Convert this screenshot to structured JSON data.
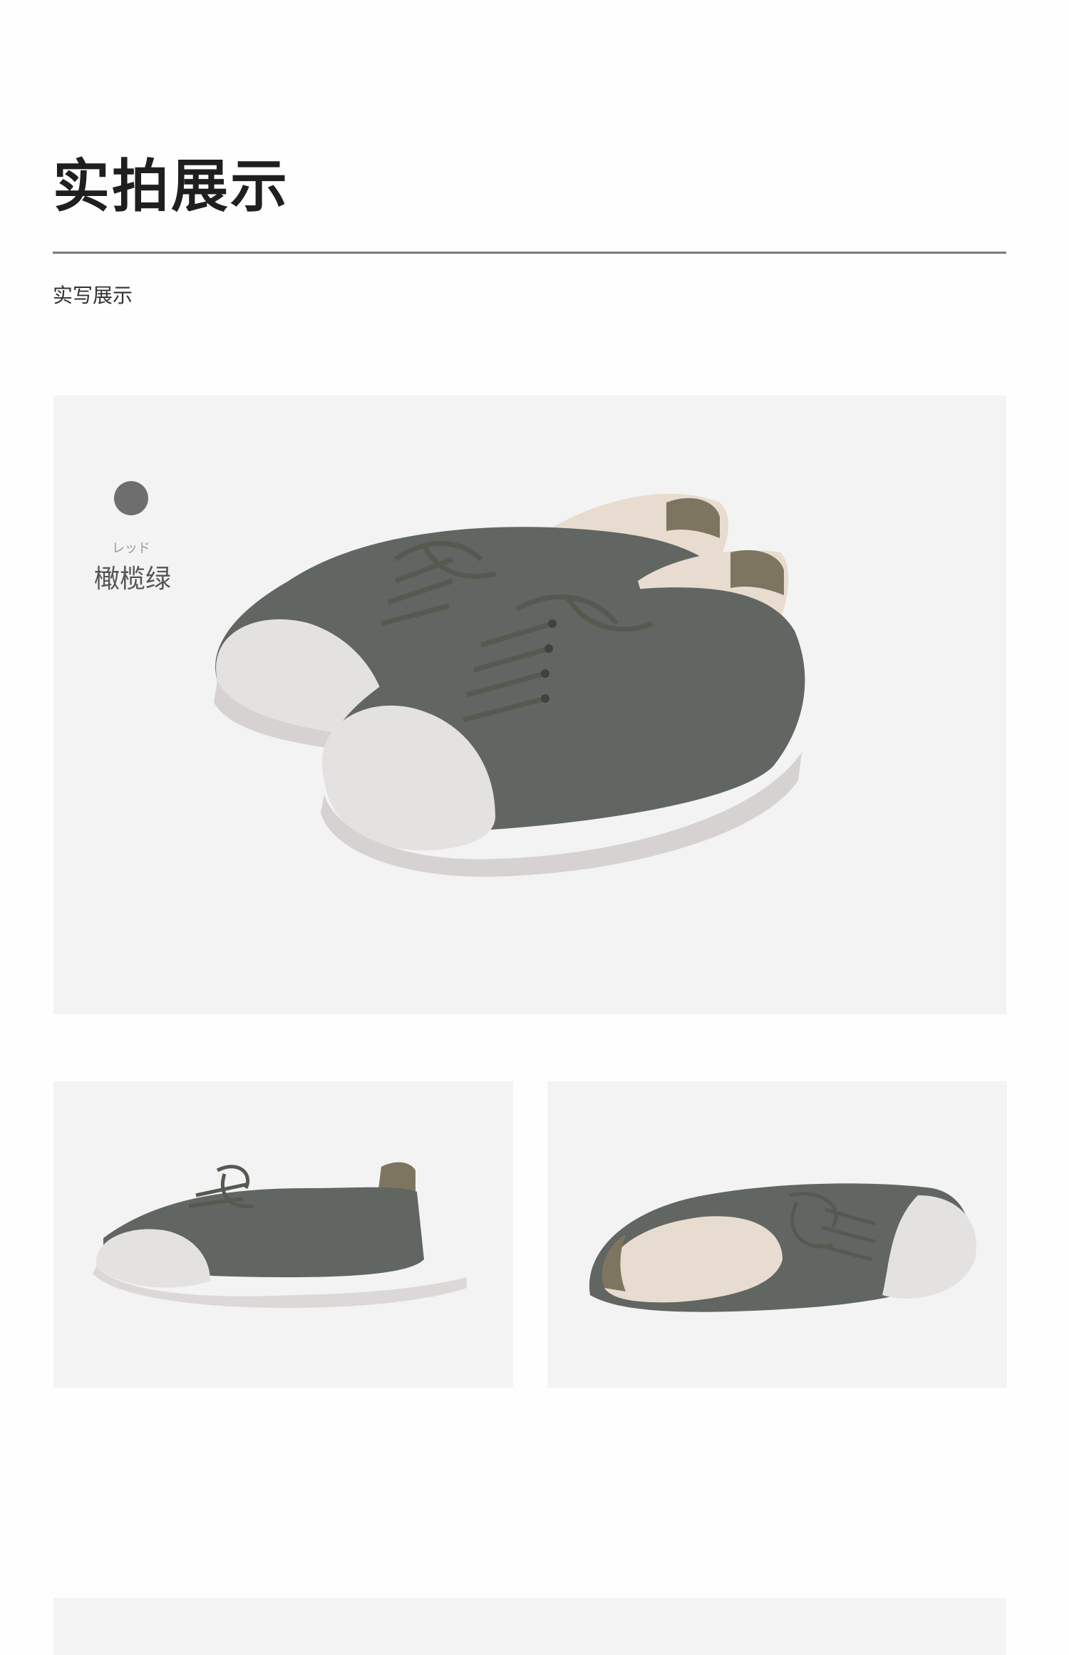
{
  "header": {
    "title": "实拍展示",
    "subtitle": "实写展示"
  },
  "hero": {
    "swatch_color": "#6e6e6e",
    "swatch_label_jp": "レッド",
    "swatch_label_cn": "橄榄绿"
  },
  "colors": {
    "upper": "#626662",
    "lace": "#55594f",
    "sole": "#e4e1e1",
    "collar": "#7e7560",
    "lining": "#e7dccf",
    "panel_bg": "#f3f3f3"
  }
}
